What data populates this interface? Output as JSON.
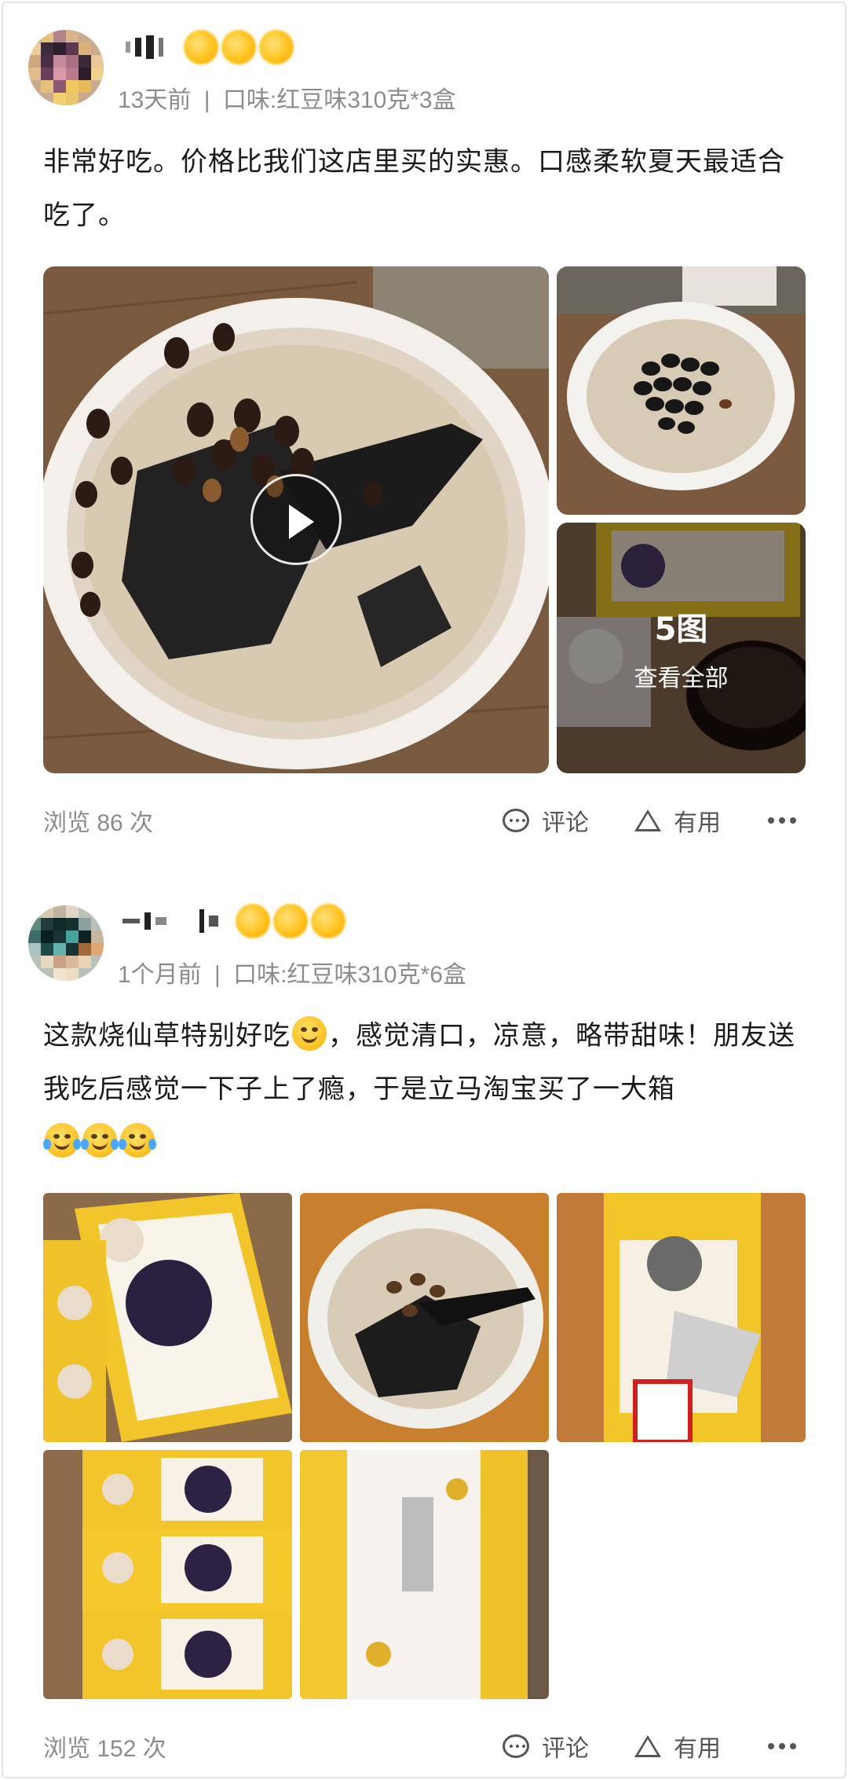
{
  "reviews": [
    {
      "time": "13天前",
      "separator": "|",
      "flavor": "口味:红豆味310克*3盒",
      "text": "非常好吃。价格比我们这店里买的实惠。口感柔软夏天最适合吃了。",
      "photo_count_label": "5图",
      "view_all_label": "查看全部",
      "views": "浏览 86 次",
      "comment_label": "评论",
      "useful_label": "有用"
    },
    {
      "time": "1个月前",
      "separator": "|",
      "flavor": "口味:红豆味310克*6盒",
      "text_part1": "这款烧仙草特别好吃",
      "text_part2": "，感觉清口，凉意，略带甜味！朋友送我吃后感觉一下子上了瘾，于是立马淘宝买了一大箱",
      "views": "浏览 152 次",
      "comment_label": "评论",
      "useful_label": "有用"
    }
  ],
  "icons": {
    "comment": "comment-icon",
    "useful": "useful-triangle-icon",
    "more": "more-dots-icon",
    "play": "play-icon"
  },
  "colors": {
    "meta_gray": "#8c8c8c",
    "medal_gold": "#ffc21a"
  }
}
